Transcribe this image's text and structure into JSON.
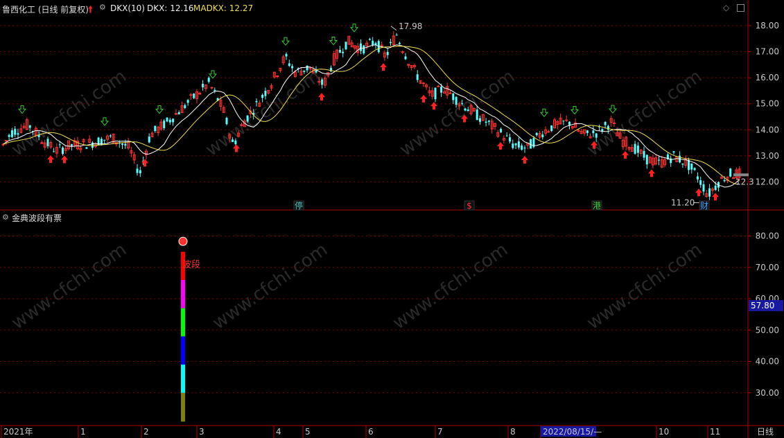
{
  "header": {
    "stock_title": "鲁西化工 (日线 前复权)",
    "dkx_label": "DKX(10)",
    "dkx_value_label": "DKX: 12.16",
    "madkx_value_label": "MADKX: 12.27"
  },
  "sub_header": {
    "indicator_title": "金典波段有票"
  },
  "watermark_text": "www.cfchi.com",
  "colors": {
    "up": "#ff3232",
    "down": "#54ffff",
    "dkx": "#ffffff",
    "madkx": "#f0e050",
    "axis": "#b00000",
    "grid": "#7a0000",
    "text": "#c8c8c8",
    "title": "#dcdcdc",
    "dkx_label_color": "#f0f0f0",
    "madkx_label_color": "#f0e050",
    "arrow_buy": "#ff2020",
    "arrow_sell": "#30d030",
    "highlight_value_bg": "#1818a0"
  },
  "chart_data": [
    {
      "type": "candlestick",
      "title": "鲁西化工 (日线 前复权)",
      "ylim": [
        11.0,
        18.4
      ],
      "yticks": [
        "18.00",
        "17.00",
        "16.00",
        "15.00",
        "14.00",
        "13.00",
        "12.00"
      ],
      "series": [
        {
          "name": "DKX(10)",
          "last_value": 12.16
        },
        {
          "name": "MADKX",
          "last_value": 12.27
        }
      ],
      "annotations": {
        "high": "17.98",
        "low": "11.20",
        "last_price": "12.3",
        "markers": [
          {
            "text": "停",
            "color": "#40c8c8"
          },
          {
            "text": "$",
            "color": "#ff3232"
          },
          {
            "text": "港",
            "color": "#40d040"
          },
          {
            "text": "财",
            "color": "#40a0ff"
          }
        ]
      }
    },
    {
      "type": "bar",
      "title": "金典波段有票",
      "ylim": [
        20,
        85
      ],
      "yticks": [
        "80.00",
        "70.00",
        "60.00",
        "50.00",
        "40.00",
        "30.00"
      ],
      "label": "波段",
      "highlight_value": "57.80",
      "segments": [
        {
          "from": 20.8,
          "to": 30.0,
          "color": "#808000"
        },
        {
          "from": 30.0,
          "to": 39.0,
          "color": "#00ffff"
        },
        {
          "from": 39.0,
          "to": 48.0,
          "color": "#0000ff"
        },
        {
          "from": 48.0,
          "to": 57.0,
          "color": "#00ff00"
        },
        {
          "from": 57.0,
          "to": 66.0,
          "color": "#ff00ff"
        },
        {
          "from": 66.0,
          "to": 75.0,
          "color": "#ff0000"
        }
      ]
    }
  ],
  "x_axis": {
    "labels": [
      "2021年",
      "1",
      "2",
      "3",
      "4",
      "5",
      "6",
      "7",
      "8",
      "2022/08/15/—",
      "10",
      "11"
    ],
    "period_label": "日线"
  }
}
